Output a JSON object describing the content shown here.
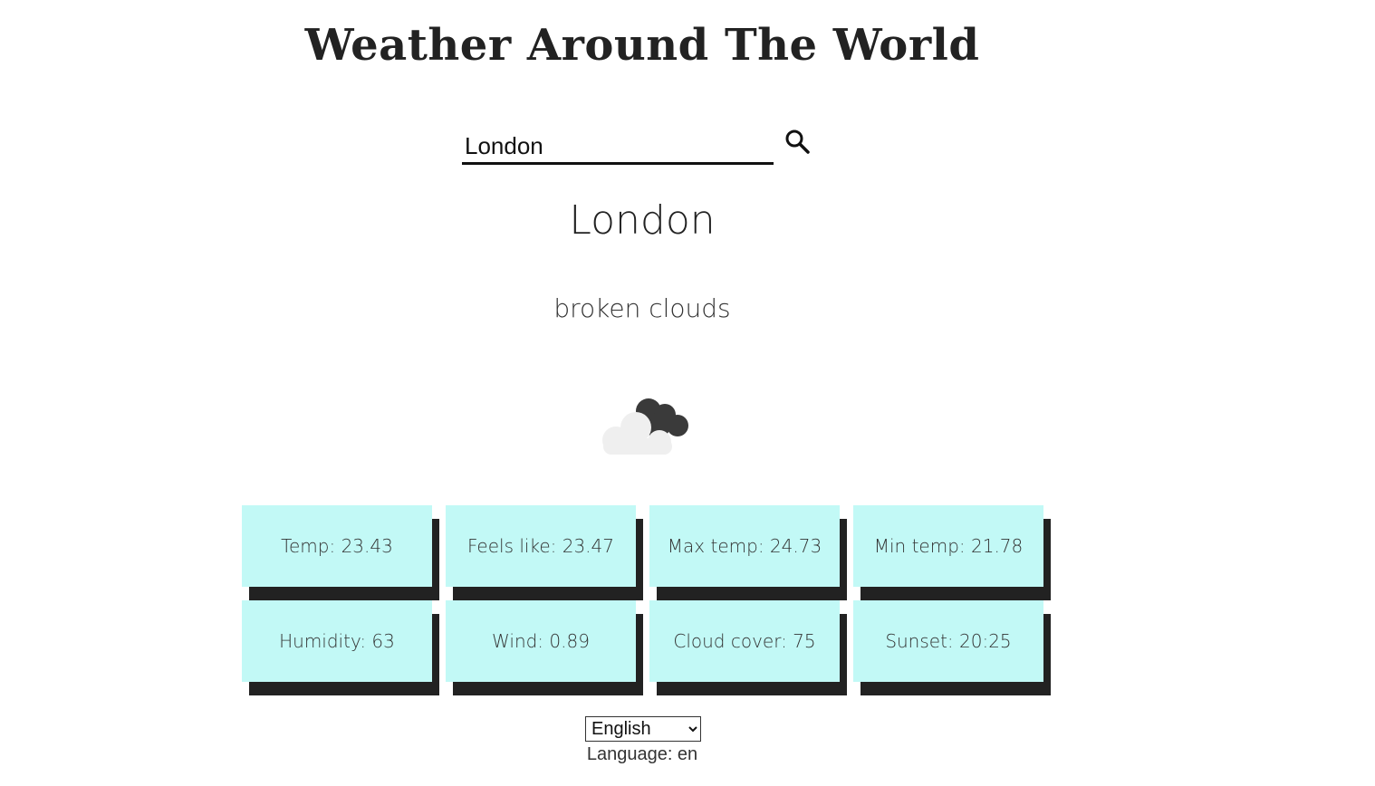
{
  "header": {
    "title": "Weather Around The World"
  },
  "search": {
    "value": "London",
    "icon": "search-icon"
  },
  "weather": {
    "city": "London",
    "description": "broken clouds",
    "icon": "broken-clouds-icon"
  },
  "stats": [
    {
      "label": "Temp: 23.43"
    },
    {
      "label": "Feels like: 23.47"
    },
    {
      "label": "Max temp: 24.73"
    },
    {
      "label": "Min temp: 21.78"
    },
    {
      "label": "Humidity: 63"
    },
    {
      "label": "Wind: 0.89"
    },
    {
      "label": "Cloud cover: 75"
    },
    {
      "label": "Sunset: 20:25"
    }
  ],
  "language": {
    "selected": "English",
    "label": "Language: en"
  },
  "colors": {
    "card_background": "#c2f9f6",
    "card_shadow": "#222222",
    "text": "#222222"
  }
}
